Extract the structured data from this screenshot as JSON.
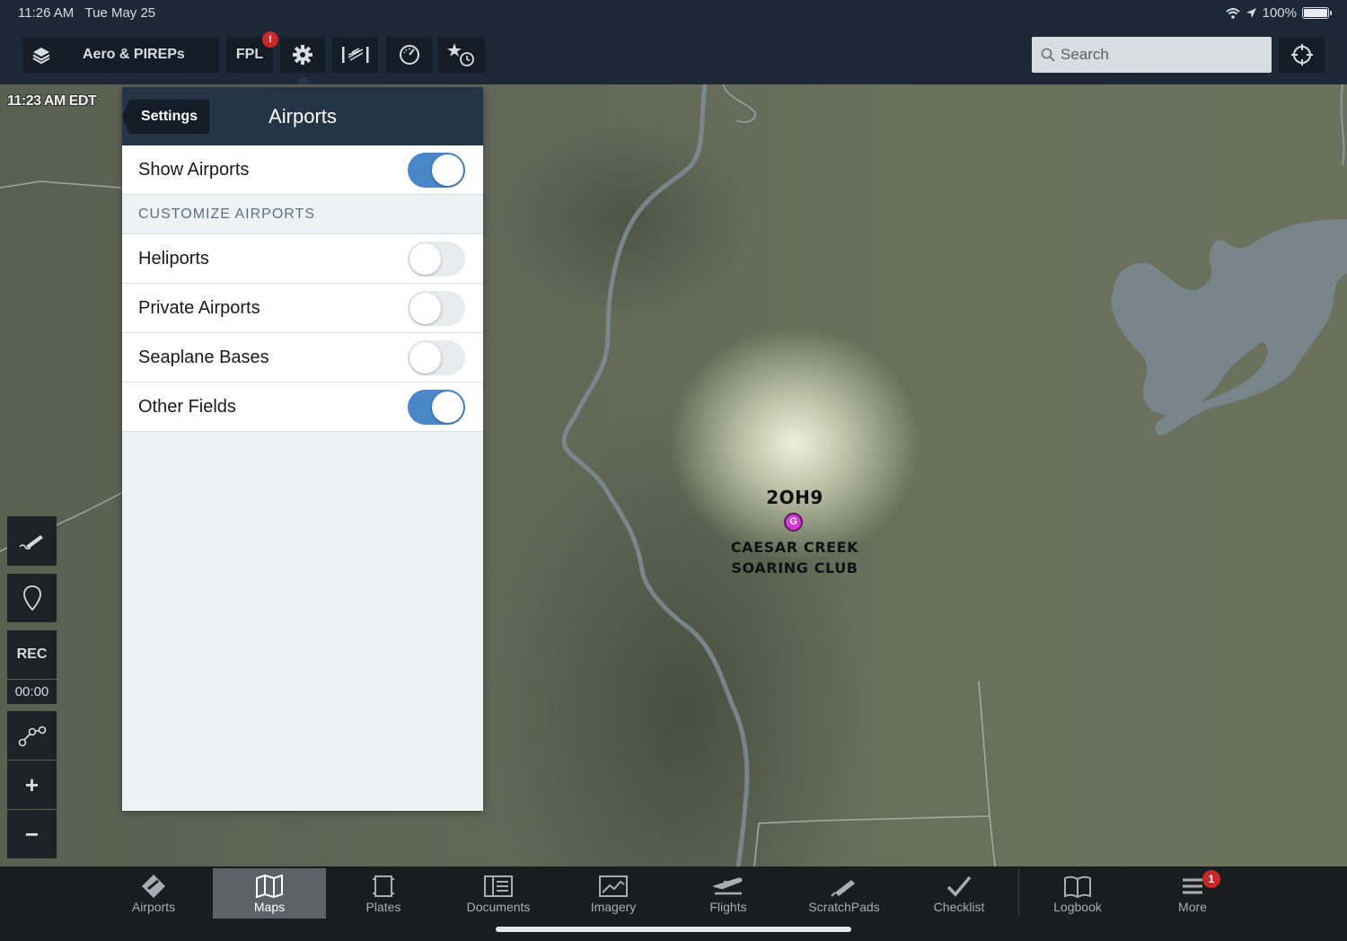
{
  "status": {
    "time": "11:26 AM",
    "date": "Tue May 25",
    "battery": "100%"
  },
  "toolbar": {
    "layers_label": "Aero & PIREPs",
    "fpl_label": "FPL",
    "fpl_badge": "!",
    "search_placeholder": "Search"
  },
  "map": {
    "timestamp": "11:23 AM EDT",
    "airport": {
      "ident": "2OH9",
      "marker": "G",
      "name_line1": "CAESAR CREEK",
      "name_line2": "SOARING CLUB"
    }
  },
  "panel": {
    "back_label": "Settings",
    "title": "Airports",
    "show_airports": {
      "label": "Show Airports",
      "on": true
    },
    "section_title": "CUSTOMIZE AIRPORTS",
    "items": [
      {
        "label": "Heliports",
        "on": false
      },
      {
        "label": "Private Airports",
        "on": false
      },
      {
        "label": "Seaplane Bases",
        "on": false
      },
      {
        "label": "Other Fields",
        "on": true
      }
    ]
  },
  "map_controls": {
    "rec_label": "REC",
    "timer": "00:00",
    "plus": "+",
    "minus": "−"
  },
  "tabs": [
    {
      "label": "Airports",
      "icon": "airport-icon"
    },
    {
      "label": "Maps",
      "icon": "map-icon",
      "active": true
    },
    {
      "label": "Plates",
      "icon": "plates-icon"
    },
    {
      "label": "Documents",
      "icon": "documents-icon"
    },
    {
      "label": "Imagery",
      "icon": "imagery-icon"
    },
    {
      "label": "Flights",
      "icon": "flights-icon"
    },
    {
      "label": "ScratchPads",
      "icon": "scratchpad-icon"
    },
    {
      "label": "Checklist",
      "icon": "checklist-icon"
    },
    {
      "label": "Logbook",
      "icon": "logbook-icon"
    },
    {
      "label": "More",
      "icon": "more-icon",
      "badge": "1"
    }
  ],
  "colors": {
    "toolbar_bg": "#1d2836",
    "panel_header": "#253447",
    "toggle_on": "#4a86c8",
    "airport_marker": "#d33ad3",
    "badge": "#c8282a"
  }
}
